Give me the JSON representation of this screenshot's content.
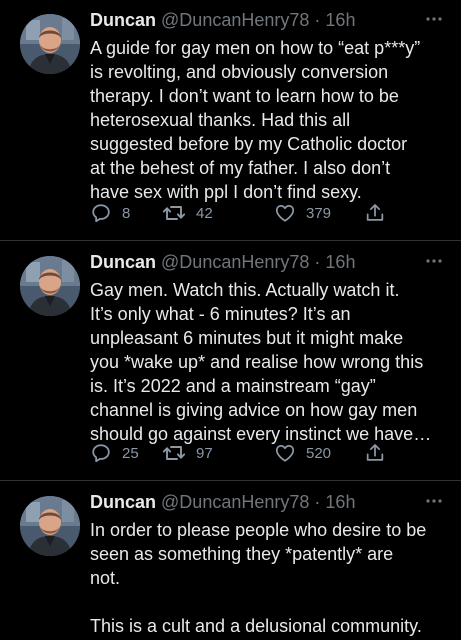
{
  "colors": {
    "background": "#000000",
    "text": "#e7e9ea",
    "secondary": "#71767b",
    "divider": "#2f3336"
  },
  "tweets": [
    {
      "display_name": "Duncan",
      "handle": "@DuncanHenry78",
      "separator": "·",
      "time": "16h",
      "text": "A guide for gay men on how to “eat p***y”\nis revolting, and obviously conversion\ntherapy. I don’t want to learn how to be\nheterosexual thanks. Had this all\nsuggested before by my Catholic doctor\nat the behest of my father. I also don’t\nhave sex with ppl I don’t find sexy.",
      "replies": "8",
      "retweets": "42",
      "likes": "379"
    },
    {
      "display_name": "Duncan",
      "handle": "@DuncanHenry78",
      "separator": "·",
      "time": "16h",
      "text": "Gay men. Watch this. Actually watch it.\nIt’s only what - 6 minutes? It’s an\nunpleasant 6 minutes but it might make\nyou *wake up* and realise how wrong this\nis. It’s 2022 and a mainstream “gay”\nchannel is giving advice on how gay men\nshould go against every instinct we have…",
      "replies": "25",
      "retweets": "97",
      "likes": "520"
    },
    {
      "display_name": "Duncan",
      "handle": "@DuncanHenry78",
      "separator": "·",
      "time": "16h",
      "text": "In order to please people who desire to be\nseen as something they *patently* are\nnot.\n\nThis is a cult and a delusional community."
    }
  ],
  "icons": {
    "reply": "reply-icon",
    "retweet": "retweet-icon",
    "like": "heart-icon",
    "share": "share-icon",
    "more": "more-icon"
  }
}
